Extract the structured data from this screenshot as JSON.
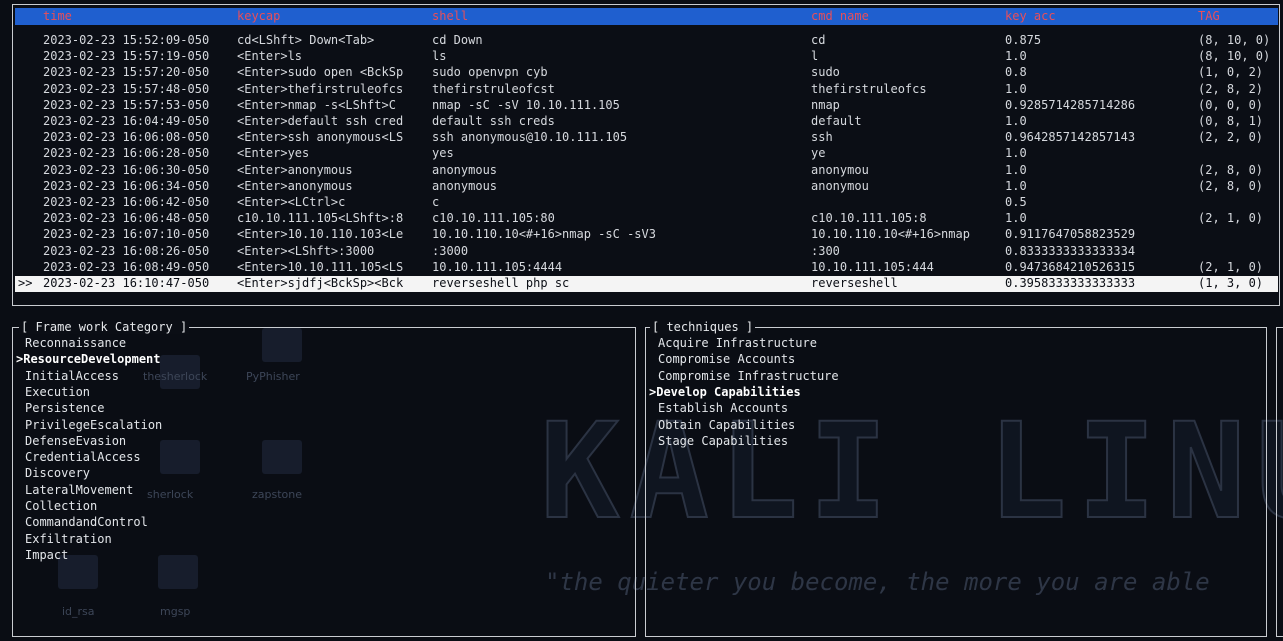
{
  "table": {
    "headers": [
      "time",
      "keycap",
      "shell",
      "cmd name",
      "key acc",
      "TAG"
    ],
    "rows": [
      {
        "time": "2023-02-23 15:52:09-050",
        "keycap": "cd<LShft> Down<Tab>",
        "shell": "cd Down",
        "cmd": "cd",
        "acc": "0.875",
        "tag": "(8, 10, 0)"
      },
      {
        "time": "2023-02-23 15:57:19-050",
        "keycap": "<Enter>ls",
        "shell": "ls",
        "cmd": "l",
        "acc": "1.0",
        "tag": "(8, 10, 0)"
      },
      {
        "time": "2023-02-23 15:57:20-050",
        "keycap": "<Enter>sudo open <BckSp",
        "shell": "sudo openvpn cyb",
        "cmd": "sudo",
        "acc": "0.8",
        "tag": "(1, 0, 2)"
      },
      {
        "time": "2023-02-23 15:57:48-050",
        "keycap": "<Enter>thefirstruleofcs",
        "shell": "thefirstruleofcst",
        "cmd": "thefirstruleofcs",
        "acc": "1.0",
        "tag": "(2, 8, 2)"
      },
      {
        "time": "2023-02-23 15:57:53-050",
        "keycap": "<Enter>nmap -s<LShft>C",
        "shell": "nmap -sC -sV 10.10.111.105",
        "cmd": "nmap",
        "acc": "0.9285714285714286",
        "tag": "(0, 0, 0)"
      },
      {
        "time": "2023-02-23 16:04:49-050",
        "keycap": "<Enter>default ssh cred",
        "shell": "default ssh creds",
        "cmd": "default",
        "acc": "1.0",
        "tag": "(0, 8, 1)"
      },
      {
        "time": "2023-02-23 16:06:08-050",
        "keycap": "<Enter>ssh anonymous<LS",
        "shell": "ssh anonymous@10.10.111.105",
        "cmd": "ssh",
        "acc": "0.9642857142857143",
        "tag": "(2, 2, 0)"
      },
      {
        "time": "2023-02-23 16:06:28-050",
        "keycap": "<Enter>yes",
        "shell": "yes",
        "cmd": "ye",
        "acc": "1.0",
        "tag": ""
      },
      {
        "time": "2023-02-23 16:06:30-050",
        "keycap": "<Enter>anonymous",
        "shell": "anonymous",
        "cmd": "anonymou",
        "acc": "1.0",
        "tag": "(2, 8, 0)"
      },
      {
        "time": "2023-02-23 16:06:34-050",
        "keycap": "<Enter>anonymous",
        "shell": "anonymous",
        "cmd": "anonymou",
        "acc": "1.0",
        "tag": "(2, 8, 0)"
      },
      {
        "time": "2023-02-23 16:06:42-050",
        "keycap": "<Enter><LCtrl>c",
        "shell": "c",
        "cmd": "",
        "acc": "0.5",
        "tag": ""
      },
      {
        "time": "2023-02-23 16:06:48-050",
        "keycap": "c10.10.111.105<LShft>:8",
        "shell": "c10.10.111.105:80",
        "cmd": "c10.10.111.105:8",
        "acc": "1.0",
        "tag": "(2, 1, 0)"
      },
      {
        "time": "2023-02-23 16:07:10-050",
        "keycap": "<Enter>10.10.110.103<Le",
        "shell": "10.10.110.10<#+16>nmap -sC -sV3",
        "cmd": "10.10.110.10<#+16>nmap",
        "acc": "0.9117647058823529",
        "tag": ""
      },
      {
        "time": "2023-02-23 16:08:26-050",
        "keycap": "<Enter><LShft>:3000",
        "shell": ":3000",
        "cmd": ":300",
        "acc": "0.8333333333333334",
        "tag": ""
      },
      {
        "time": "2023-02-23 16:08:49-050",
        "keycap": "<Enter>10.10.111.105<LS",
        "shell": "10.10.111.105:4444",
        "cmd": "10.10.111.105:444",
        "acc": "0.9473684210526315",
        "tag": "(2, 1, 0)"
      },
      {
        "time": "2023-02-23 16:10:47-050",
        "keycap": "<Enter>sjdfj<BckSp><Bck",
        "shell": "reverseshell php sc",
        "cmd": "reverseshell",
        "acc": "0.3958333333333333",
        "tag": "(1, 3, 0)",
        "selected": true,
        "pointer": ">>"
      }
    ]
  },
  "framework": {
    "title": "[ Frame work Category ]",
    "items": [
      "Reconnaissance",
      ">ResourceDevelopment",
      "InitialAccess",
      "Execution",
      "Persistence",
      "PrivilegeEscalation",
      "DefenseEvasion",
      "CredentialAccess",
      "Discovery",
      "LateralMovement",
      "Collection",
      "CommandandControl",
      "Exfiltration",
      "Impact"
    ],
    "active_index": 1
  },
  "techniques": {
    "title": "[ techniques ]",
    "items": [
      "Acquire Infrastructure",
      "Compromise Accounts",
      "Compromise Infrastructure",
      ">Develop Capabilities",
      "Establish Accounts",
      "Obtain Capabilities",
      "Stage Capabilities"
    ],
    "active_index": 3
  },
  "background": {
    "wordmark": "KALI LINU",
    "quote": "\"the quieter you become, the more you are able",
    "desktop_labels": [
      "thesherlock",
      "PyPhisher",
      "sherlock",
      "zapstone",
      "id_rsa",
      "mgsp"
    ]
  },
  "colors": {
    "header_bg": "#1f5fcf",
    "header_text": "#e84f5a",
    "selected_bg": "#f4f4f4",
    "terminal_bg": "#0b0e15"
  }
}
